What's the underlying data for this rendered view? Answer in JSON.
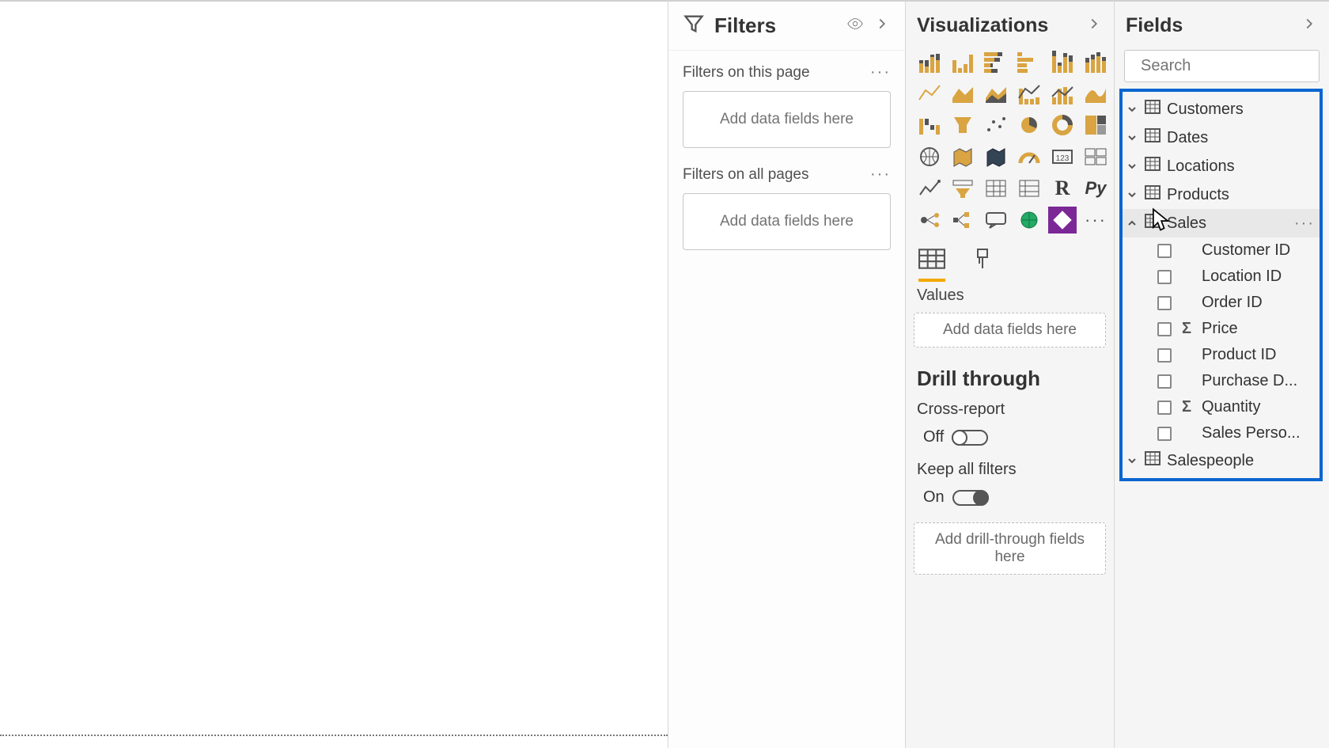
{
  "filters": {
    "title": "Filters",
    "page_label": "Filters on this page",
    "page_drop": "Add data fields here",
    "all_label": "Filters on all pages",
    "all_drop": "Add data fields here"
  },
  "visualizations": {
    "title": "Visualizations",
    "values_label": "Values",
    "values_drop": "Add data fields here",
    "drill_title": "Drill through",
    "cross_label": "Cross-report",
    "cross_state": "Off",
    "keep_label": "Keep all filters",
    "keep_state": "On",
    "drill_drop": "Add drill-through fields here",
    "icons": [
      "stacked-bar",
      "clustered-bar",
      "stacked-bar-h",
      "clustered-bar-h",
      "100-stacked-bar",
      "100-stacked-column",
      "line",
      "area",
      "stacked-area",
      "line-stacked",
      "line-clustered",
      "ribbon",
      "waterfall",
      "funnel",
      "scatter",
      "pie",
      "donut",
      "treemap",
      "map",
      "filled-map",
      "shape-map",
      "gauge",
      "card",
      "multi-card",
      "kpi",
      "slicer",
      "table",
      "matrix",
      "r",
      "py",
      "key-influencer",
      "decomp",
      "qna",
      "globe",
      "powerapps",
      "more"
    ]
  },
  "fields": {
    "title": "Fields",
    "search_placeholder": "Search",
    "tables": [
      {
        "name": "Customers",
        "expanded": false
      },
      {
        "name": "Dates",
        "expanded": false
      },
      {
        "name": "Locations",
        "expanded": false
      },
      {
        "name": "Products",
        "expanded": false
      },
      {
        "name": "Sales",
        "expanded": true,
        "hovered": true,
        "fields": [
          {
            "name": "Customer ID",
            "sigma": false
          },
          {
            "name": "Location ID",
            "sigma": false
          },
          {
            "name": "Order ID",
            "sigma": false
          },
          {
            "name": "Price",
            "sigma": true
          },
          {
            "name": "Product ID",
            "sigma": false
          },
          {
            "name": "Purchase D...",
            "sigma": false
          },
          {
            "name": "Quantity",
            "sigma": true
          },
          {
            "name": "Sales Perso...",
            "sigma": false
          }
        ]
      },
      {
        "name": "Salespeople",
        "expanded": false
      }
    ]
  }
}
